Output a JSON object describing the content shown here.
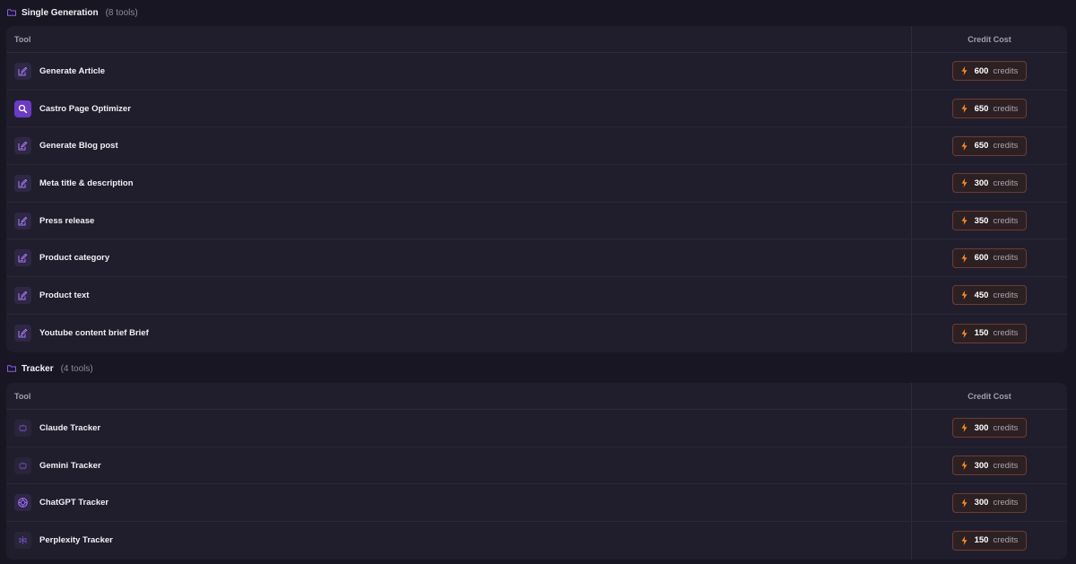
{
  "sections": [
    {
      "title": "Single Generation",
      "count": "(8 tools)",
      "header": {
        "tool": "Tool",
        "cost": "Credit Cost"
      },
      "rows": [
        {
          "icon": "edit-icon",
          "name": "Generate Article",
          "credits": "600",
          "unit": "credits"
        },
        {
          "icon": "search-icon",
          "name": "Castro Page Optimizer",
          "credits": "650",
          "unit": "credits"
        },
        {
          "icon": "edit-icon",
          "name": "Generate Blog post",
          "credits": "650",
          "unit": "credits"
        },
        {
          "icon": "edit-icon",
          "name": "Meta title & description",
          "credits": "300",
          "unit": "credits"
        },
        {
          "icon": "edit-icon",
          "name": "Press release",
          "credits": "350",
          "unit": "credits"
        },
        {
          "icon": "edit-icon",
          "name": "Product category",
          "credits": "600",
          "unit": "credits"
        },
        {
          "icon": "edit-icon",
          "name": "Product text",
          "credits": "450",
          "unit": "credits"
        },
        {
          "icon": "edit-icon",
          "name": "Youtube content brief Brief",
          "credits": "150",
          "unit": "credits"
        }
      ]
    },
    {
      "title": "Tracker",
      "count": "(4 tools)",
      "header": {
        "tool": "Tool",
        "cost": "Credit Cost"
      },
      "rows": [
        {
          "icon": "claude-icon",
          "name": "Claude Tracker",
          "credits": "300",
          "unit": "credits"
        },
        {
          "icon": "gemini-icon",
          "name": "Gemini Tracker",
          "credits": "300",
          "unit": "credits"
        },
        {
          "icon": "chatgpt-icon",
          "name": "ChatGPT Tracker",
          "credits": "300",
          "unit": "credits"
        },
        {
          "icon": "perplexity-icon",
          "name": "Perplexity Tracker",
          "credits": "150",
          "unit": "credits"
        }
      ]
    }
  ],
  "colors": {
    "background": "#181622",
    "panel": "#201e2c",
    "accent": "#8b5cf6",
    "credit_accent": "#f28c28"
  }
}
